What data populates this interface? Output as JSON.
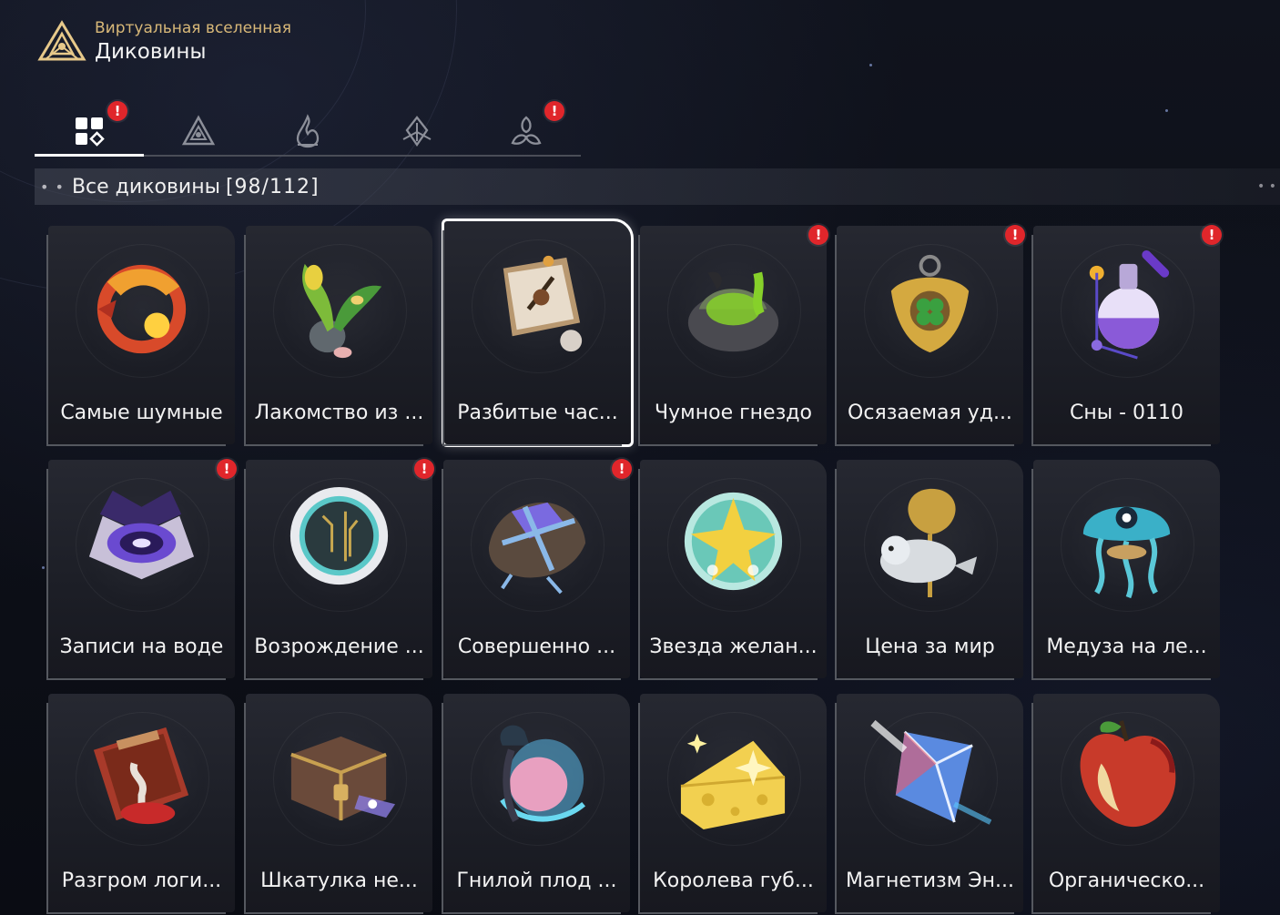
{
  "header": {
    "subtitle": "Виртуальная вселенная",
    "title": "Диковины",
    "logo_icon": "triangle-emblem-icon"
  },
  "tabs": [
    {
      "icon": "grid-category-icon",
      "active": true,
      "alert": "!"
    },
    {
      "icon": "triangle-emblem-icon",
      "active": false,
      "alert": ""
    },
    {
      "icon": "flame-emblem-icon",
      "active": false,
      "alert": ""
    },
    {
      "icon": "leaf-emblem-icon",
      "active": false,
      "alert": ""
    },
    {
      "icon": "trefoil-emblem-icon",
      "active": false,
      "alert": "!"
    }
  ],
  "section": {
    "dots": "• •",
    "label": "Все диковины",
    "count": "[98/112]",
    "end_dots": "• •"
  },
  "cards": [
    {
      "label": "Самые шумные",
      "icon": "fire-dragon-icon",
      "alert": "",
      "selected": false,
      "color": "#d84a2a"
    },
    {
      "label": "Лакомство из ...",
      "icon": "seaweed-plant-icon",
      "alert": "",
      "selected": false,
      "color": "#7dbb3a"
    },
    {
      "label": "Разбитые час...",
      "icon": "broken-clock-icon",
      "alert": "",
      "selected": true,
      "color": "#b89870"
    },
    {
      "label": "Чумное гнездо",
      "icon": "plague-nest-icon",
      "alert": "!",
      "selected": false,
      "color": "#86d02a"
    },
    {
      "label": "Осязаемая уд...",
      "icon": "clover-amulet-icon",
      "alert": "!",
      "selected": false,
      "color": "#d4a940"
    },
    {
      "label": "Сны - 0110",
      "icon": "potion-flask-icon",
      "alert": "!",
      "selected": false,
      "color": "#8a5ad8"
    },
    {
      "label": "Записи на воде",
      "icon": "vortex-book-icon",
      "alert": "!",
      "selected": false,
      "color": "#6a4ad0"
    },
    {
      "label": "Возрождение ...",
      "icon": "circuit-disc-icon",
      "alert": "!",
      "selected": false,
      "color": "#5ac8c8"
    },
    {
      "label": "Совершенно ...",
      "icon": "wrapped-package-icon",
      "alert": "!",
      "selected": false,
      "color": "#7a6ae0"
    },
    {
      "label": "Звезда желан...",
      "icon": "wish-star-orb-icon",
      "alert": "",
      "selected": false,
      "color": "#f2d040"
    },
    {
      "label": "Цена за мир",
      "icon": "seal-trophy-icon",
      "alert": "",
      "selected": false,
      "color": "#c8a040"
    },
    {
      "label": "Медуза на ле...",
      "icon": "jellyfish-icon",
      "alert": "",
      "selected": false,
      "color": "#3ab0c8"
    },
    {
      "label": "Разгром логи...",
      "icon": "bloody-book-icon",
      "alert": "",
      "selected": false,
      "color": "#a83a2a"
    },
    {
      "label": "Шкатулка не...",
      "icon": "treasure-chest-icon",
      "alert": "",
      "selected": false,
      "color": "#6a4a3a"
    },
    {
      "label": "Гнилой плод ...",
      "icon": "rotten-fruit-icon",
      "alert": "",
      "selected": false,
      "color": "#e8a0c0"
    },
    {
      "label": "Королева губ...",
      "icon": "cheese-icon",
      "alert": "",
      "selected": false,
      "color": "#f2d050"
    },
    {
      "label": "Магнетизм Эн...",
      "icon": "crystal-prism-icon",
      "alert": "",
      "selected": false,
      "color": "#5a8ae0"
    },
    {
      "label": "Органическо...",
      "icon": "apple-heart-icon",
      "alert": "",
      "selected": false,
      "color": "#c83a2a"
    }
  ]
}
